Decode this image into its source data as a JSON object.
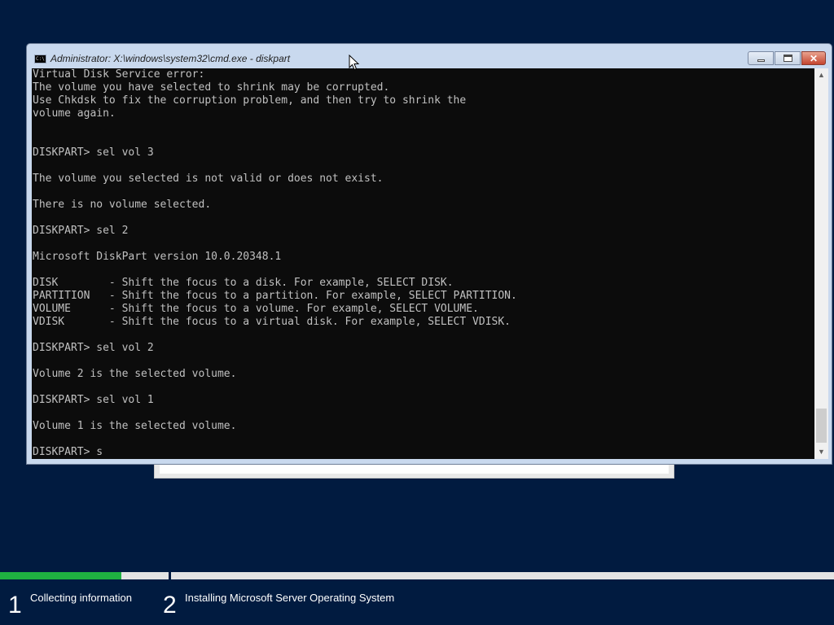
{
  "window": {
    "title": "Administrator: X:\\windows\\system32\\cmd.exe - diskpart",
    "icon": "cmd-app-icon",
    "close_glyph": "✕"
  },
  "console": {
    "lines": [
      "Virtual Disk Service error:",
      "The volume you have selected to shrink may be corrupted.",
      "Use Chkdsk to fix the corruption problem, and then try to shrink the",
      "volume again.",
      "",
      "",
      "DISKPART> sel vol 3",
      "",
      "The volume you selected is not valid or does not exist.",
      "",
      "There is no volume selected.",
      "",
      "DISKPART> sel 2",
      "",
      "Microsoft DiskPart version 10.0.20348.1",
      "",
      "DISK        - Shift the focus to a disk. For example, SELECT DISK.",
      "PARTITION   - Shift the focus to a partition. For example, SELECT PARTITION.",
      "VOLUME      - Shift the focus to a volume. For example, SELECT VOLUME.",
      "VDISK       - Shift the focus to a virtual disk. For example, SELECT VDISK.",
      "",
      "DISKPART> sel vol 2",
      "",
      "Volume 2 is the selected volume.",
      "",
      "DISKPART> sel vol 1",
      "",
      "Volume 1 is the selected volume.",
      "",
      "DISKPART> s"
    ]
  },
  "setup_progress": {
    "step1_fill_fraction": 0.72,
    "accent": "#1fb141",
    "steps": [
      {
        "number": "1",
        "label": "Collecting information"
      },
      {
        "number": "2",
        "label": "Installing Microsoft Server Operating System"
      }
    ]
  },
  "colors": {
    "desktop_background": "#011b40",
    "console_background": "#0c0c0c",
    "console_text": "#c0c0c0"
  }
}
